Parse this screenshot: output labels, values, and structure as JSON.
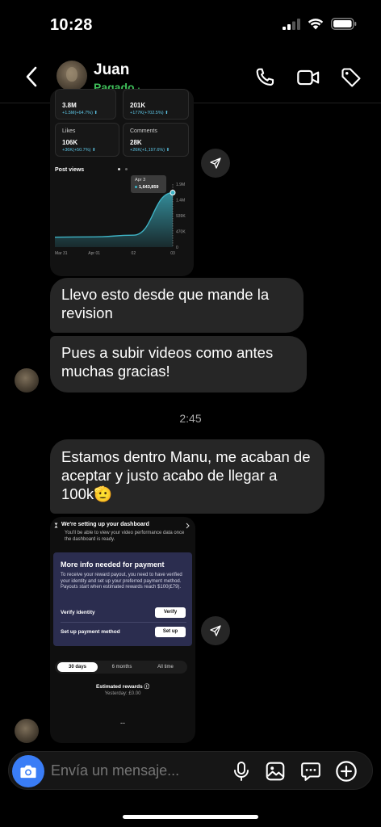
{
  "status_bar": {
    "time": "10:28"
  },
  "header": {
    "contact_name": "Juan",
    "contact_status": "Pagado",
    "status_dot": "·",
    "icons": [
      "back-chevron-icon",
      "phone-icon",
      "video-camera-icon",
      "tag-icon"
    ]
  },
  "stats_image": {
    "top_left_value": "3.8M",
    "top_left_delta": "+1.5M(+64.7%) ⬆",
    "top_right_value": "201K",
    "top_right_delta": "+177K(+702.5%) ⬆",
    "likes_label": "Likes",
    "likes_value": "106K",
    "likes_delta": "+36K(+50.7%) ⬆",
    "comments_label": "Comments",
    "comments_value": "28K",
    "comments_delta": "+26K(+1,197.6%) ⬆",
    "post_views_title": "Post views",
    "tooltip_date": "Apr 3",
    "tooltip_value": "1,643,859"
  },
  "chart_data": {
    "type": "area",
    "title": "Post views",
    "x_ticks": [
      "Mar 31",
      "Apr 01",
      "02",
      "03"
    ],
    "y_ticks": [
      "1.9M",
      "1.4M",
      "939K",
      "470K",
      "0"
    ],
    "x": [
      "Mar 31",
      "Apr 01",
      "02",
      "03"
    ],
    "values": [
      300000,
      310000,
      360000,
      1643859
    ],
    "ylim": [
      0,
      1900000
    ],
    "color": "#3fb4c6",
    "grid": false
  },
  "messages": [
    {
      "text": "Llevo esto desde que mande la revision"
    },
    {
      "text": "Pues a subir videos como antes muchas gracias!"
    },
    {
      "text": "Estamos dentro Manu, me acaban de aceptar y justo acabo de llegar a 100k🫡"
    }
  ],
  "timestamp": "2:45",
  "dashboard_image": {
    "setup_title": "We're setting up your dashboard",
    "setup_sub": "You'll be able to view your video performance data once the dashboard is ready.",
    "payment_title": "More info needed for payment",
    "payment_desc": "To receive your reward payout, you need to have verified your identity and set up your preferred payment method. Payouts start when estimated rewards reach $100(£79).",
    "verify_label": "Verify identity",
    "verify_btn": "Verify",
    "method_label": "Set up payment method",
    "method_btn": "Set up",
    "tabs": [
      "30 days",
      "6 months",
      "All time"
    ],
    "est_title": "Estimated rewards ⓘ",
    "est_sub": "Yesterday: £0.00",
    "est_value": "--"
  },
  "composer": {
    "placeholder": "Envía un mensaje...",
    "icons": [
      "camera-icon",
      "microphone-icon",
      "gallery-icon",
      "chat-sticker-icon",
      "plus-icon"
    ]
  },
  "colors": {
    "accent": "#3a7df6",
    "status_green": "#3fbf5a",
    "bubble": "#262626",
    "chart": "#3fb4c6"
  }
}
